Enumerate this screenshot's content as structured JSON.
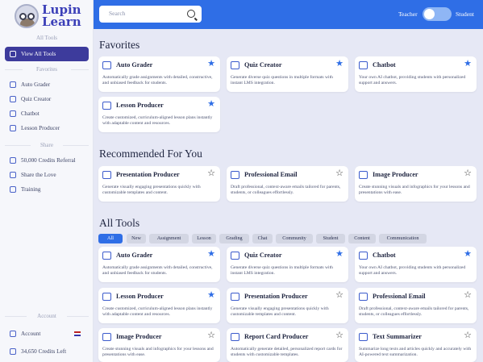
{
  "brand": {
    "name_line1": "Lupin",
    "name_line2": "Learn"
  },
  "sidebar": {
    "all_tools_title": "All Tools",
    "view_all": "View All Tools",
    "favorites_title": "Favorites",
    "favorites": [
      "Auto Grader",
      "Quiz Creator",
      "Chatbot",
      "Lesson Producer"
    ],
    "share_title": "Share",
    "share": [
      "50,000 Credits Referral",
      "Share the Love",
      "Training"
    ],
    "account_title": "Account",
    "account_label": "Account",
    "credits": "34,650 Credits Left"
  },
  "topbar": {
    "search_placeholder": "Search",
    "toggle_left": "Teacher",
    "toggle_right": "Student"
  },
  "sections": {
    "favorites": "Favorites",
    "recommended": "Recommended For You",
    "all_tools": "All Tools"
  },
  "filters": [
    "All",
    "New",
    "Assignment",
    "Lesson",
    "Grading",
    "Chat",
    "Community",
    "Student",
    "Content",
    "Communication"
  ],
  "favorites_cards": [
    {
      "title": "Auto Grader",
      "desc": "Automatically grade assignments with detailed, constructive, and unbiased feedback for students.",
      "starred": true
    },
    {
      "title": "Quiz Creator",
      "desc": "Generate diverse quiz questions in multiple formats with instant LMS integration.",
      "starred": true
    },
    {
      "title": "Chatbot",
      "desc": "Your own AI chatbot, providing students with personalized support and answers.",
      "starred": true
    },
    {
      "title": "Lesson Producer",
      "desc": "Create customized, curriculum-aligned lesson plans instantly with adaptable content and resources.",
      "starred": true
    }
  ],
  "recommended_cards": [
    {
      "title": "Presentation Producer",
      "desc": "Generate visually engaging presentations quickly with customizable templates and content.",
      "starred": false
    },
    {
      "title": "Professional Email",
      "desc": "Draft professional, context-aware emails tailored for parents, students, or colleagues effortlessly.",
      "starred": false
    },
    {
      "title": "Image Producer",
      "desc": "Create stunning visuals and infographics for your lessons and presentations with ease.",
      "starred": false
    }
  ],
  "all_cards": [
    {
      "title": "Auto Grader",
      "desc": "Automatically grade assignments with detailed, constructive, and unbiased feedback for students.",
      "starred": true
    },
    {
      "title": "Quiz Creator",
      "desc": "Generate diverse quiz questions in multiple formats with instant LMS integration.",
      "starred": true
    },
    {
      "title": "Chatbot",
      "desc": "Your own AI chatbot, providing students with personalized support and answers.",
      "starred": true
    },
    {
      "title": "Lesson Producer",
      "desc": "Create customized, curriculum-aligned lesson plans instantly with adaptable content and resources.",
      "starred": true
    },
    {
      "title": "Presentation Producer",
      "desc": "Generate visually engaging presentations quickly with customizable templates and content.",
      "starred": false
    },
    {
      "title": "Professional Email",
      "desc": "Draft professional, context-aware emails tailored for parents, students, or colleagues effortlessly.",
      "starred": false
    },
    {
      "title": "Image Producer",
      "desc": "Create stunning visuals and infographics for your lessons and presentations with ease.",
      "starred": false
    },
    {
      "title": "Report Card Producer",
      "desc": "Automatically generate detailed, personalized report cards for students with customizable templates.",
      "starred": false
    },
    {
      "title": "Text Summarizer",
      "desc": "Summarize long texts and articles quickly and accurately with AI-powered text summarization.",
      "starred": false
    }
  ]
}
